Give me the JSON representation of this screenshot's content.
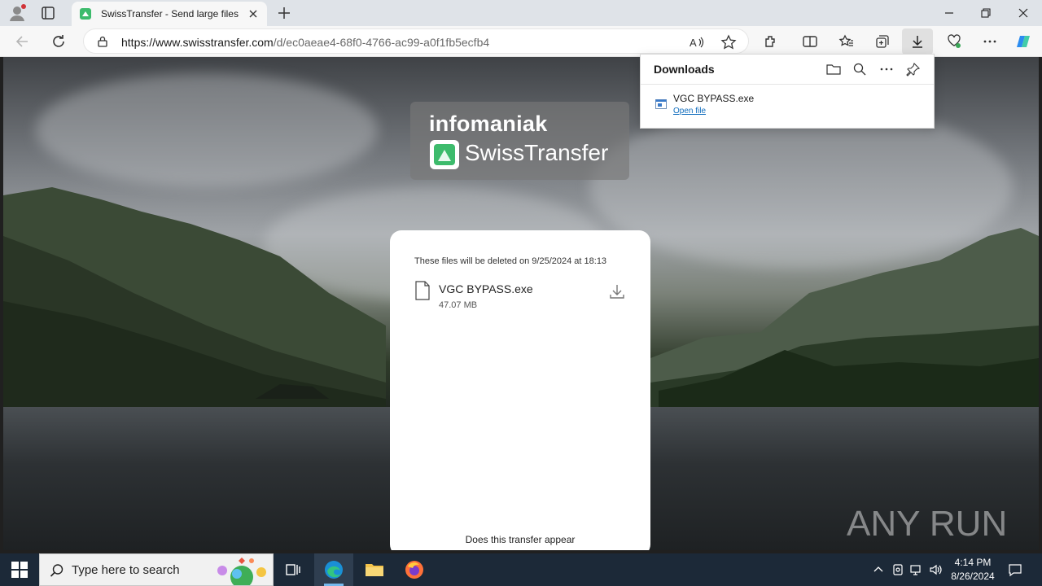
{
  "browser": {
    "tab_title": "SwissTransfer - Send large files se",
    "url_host": "https://www.swisstransfer.com",
    "url_path": "/d/ec0aeae4-68f0-4766-ac99-a0f1fb5ecfb4",
    "accent": "#0f6cbd"
  },
  "downloads": {
    "title": "Downloads",
    "item_name": "VGC BYPASS.exe",
    "item_action": "Open file"
  },
  "page": {
    "brand_company": "infomaniak",
    "brand_product": "SwissTransfer",
    "notice": "These files will be deleted on 9/25/2024 at 18:13",
    "file_name": "VGC BYPASS.exe",
    "file_size": "47.07 MB",
    "question": "Does this transfer appear",
    "watermark": "ANY RUN"
  },
  "taskbar": {
    "search_placeholder": "Type here to search",
    "time": "4:14 PM",
    "date": "8/26/2024"
  }
}
